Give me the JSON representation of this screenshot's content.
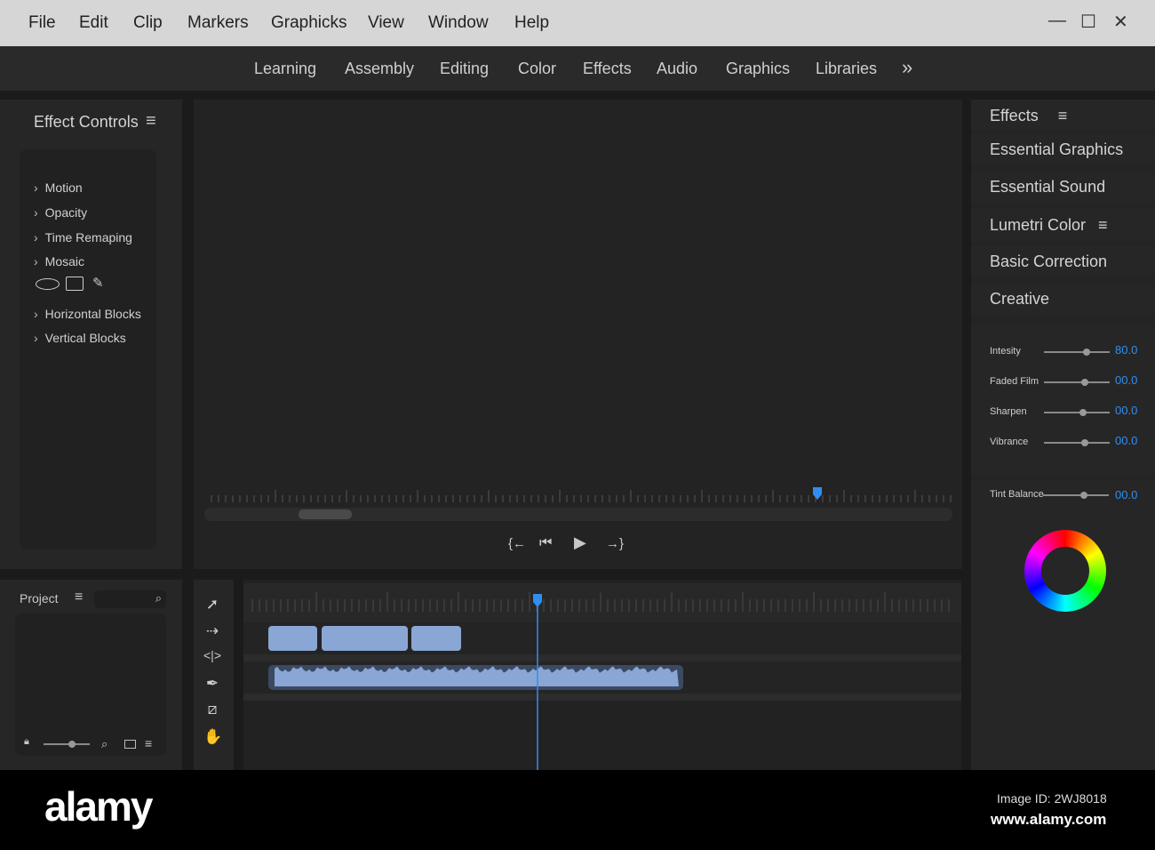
{
  "menu": [
    "File",
    "Edit",
    "Clip",
    "Markers",
    "Graphicks",
    "View",
    "Window",
    "Help"
  ],
  "window_controls": {
    "minimize": "—",
    "maximize": "☐",
    "close": "✕"
  },
  "workspaces": [
    "Learning",
    "Assembly",
    "Editing",
    "Color",
    "Effects",
    "Audio",
    "Graphics",
    "Libraries"
  ],
  "workspaces_more": "»",
  "effect_controls": {
    "title": "Effect Controls",
    "items": [
      "Motion",
      "Opacity",
      "Time Remaping",
      "Mosaic",
      "Horizontal Blocks",
      "Vertical Blocks"
    ]
  },
  "right_panel": {
    "effects": "Effects",
    "essential_graphics": "Essential Graphics",
    "essential_sound": "Essential Sound",
    "lumetri": "Lumetri Color",
    "basic_correction": "Basic Correction",
    "creative": "Creative",
    "sliders": [
      {
        "label": "Intesity",
        "value": "80.0",
        "level": 0.65
      },
      {
        "label": "Faded Film",
        "value": "00.0",
        "level": 0.62
      },
      {
        "label": "Sharpen",
        "value": "00.0",
        "level": 0.6
      },
      {
        "label": "Vibrance",
        "value": "00.0",
        "level": 0.62
      }
    ],
    "tint": {
      "label": "Tint Balance",
      "value": "00.0",
      "level": 0.62
    }
  },
  "project": {
    "title": "Project"
  },
  "accent": "#2f8ff0",
  "footer": {
    "logo": "alamy",
    "image_id": "Image ID: 2WJ8018",
    "url": "www.alamy.com"
  }
}
